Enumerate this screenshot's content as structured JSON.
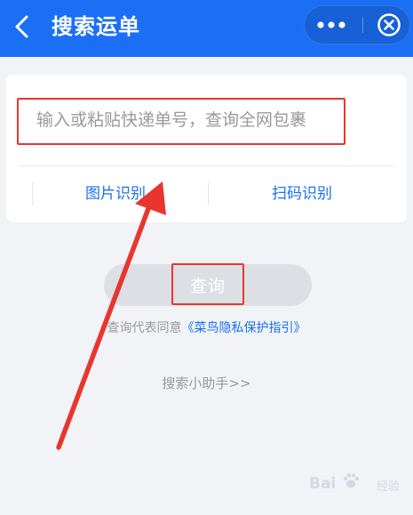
{
  "header": {
    "title": "搜索运单",
    "back_icon": "chevron-left-icon",
    "more_icon": "more-dots-icon",
    "close_icon": "close-circle-icon",
    "bg_color": "#1b6ff5"
  },
  "search": {
    "placeholder": "输入或粘贴快递单号，查询全网包裹",
    "value": ""
  },
  "options": {
    "image_recognition": "图片识别",
    "scan_code": "扫码识别"
  },
  "query_button": {
    "label": "查询"
  },
  "agreement": {
    "prefix": "查询代表同意",
    "link": "《菜鸟隐私保护指引》"
  },
  "helper": {
    "label": "搜索小助手>>"
  },
  "annotation": {
    "highlight_color": "#e8362f"
  },
  "watermark": {
    "text": "Bai",
    "text2": "经验"
  }
}
